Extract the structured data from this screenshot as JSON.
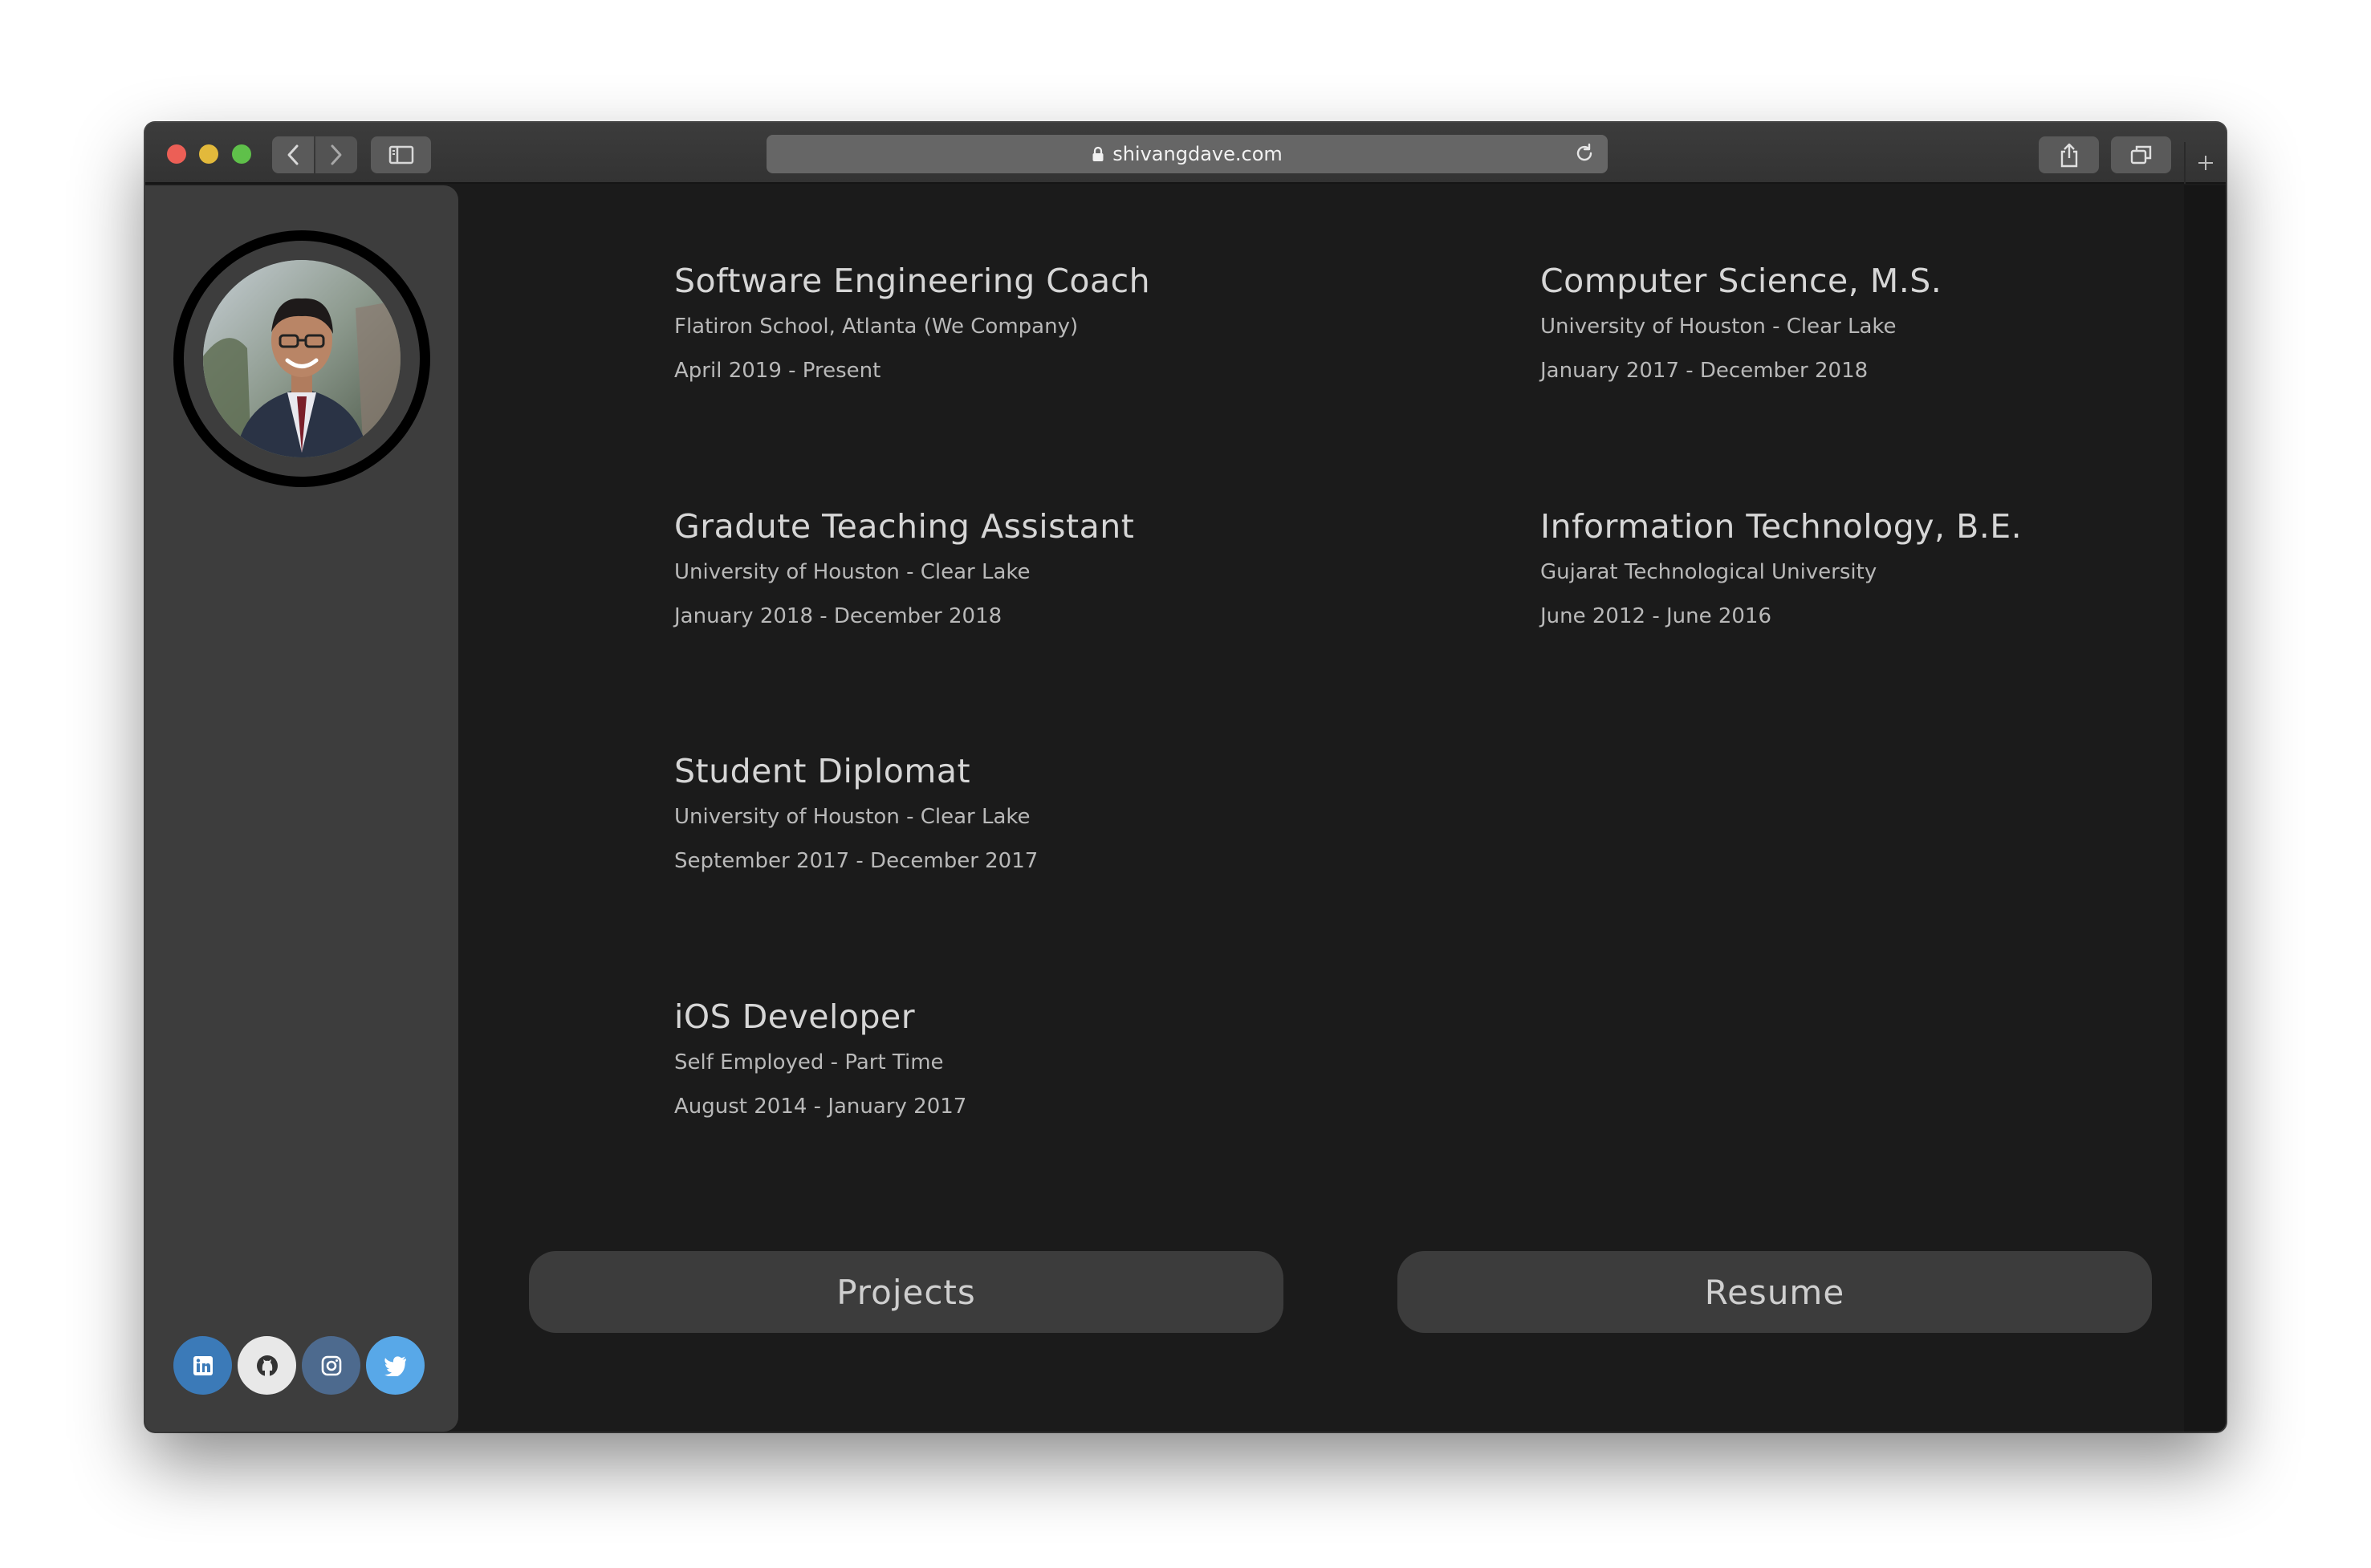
{
  "browser": {
    "url": "shivangdave.com",
    "icons": {
      "back": "chevron-left-icon",
      "forward": "chevron-right-icon",
      "sidebar": "sidebar-icon",
      "lock": "lock-icon",
      "reload": "reload-icon",
      "share": "share-icon",
      "tabs": "tabs-icon",
      "new_tab": "plus-icon"
    }
  },
  "sidebar": {
    "socials": [
      {
        "name": "linkedin",
        "icon": "linkedin-icon",
        "color": "#3b7ab8"
      },
      {
        "name": "github",
        "icon": "github-icon",
        "color": "#e8e8e8"
      },
      {
        "name": "instagram",
        "icon": "instagram-icon",
        "color": "#4d6a8e"
      },
      {
        "name": "twitter",
        "icon": "twitter-icon",
        "color": "#58a8e8"
      }
    ]
  },
  "experience": [
    {
      "title": "Software Engineering Coach",
      "org": "Flatiron School, Atlanta (We Company)",
      "dates": "April 2019 - Present"
    },
    {
      "title": "Gradute Teaching Assistant",
      "org": "University of Houston - Clear Lake",
      "dates": "January 2018 - December 2018"
    },
    {
      "title": "Student Diplomat",
      "org": "University of Houston - Clear Lake",
      "dates": "September 2017 - December 2017"
    },
    {
      "title": "iOS Developer",
      "org": "Self Employed - Part Time",
      "dates": "August 2014 - January 2017"
    }
  ],
  "education": [
    {
      "title": "Computer Science, M.S.",
      "org": "University of Houston - Clear Lake",
      "dates": "January 2017 - December 2018"
    },
    {
      "title": "Information Technology, B.E.",
      "org": "Gujarat Technological University",
      "dates": "June 2012 - June 2016"
    }
  ],
  "buttons": {
    "projects": "Projects",
    "resume": "Resume"
  },
  "colors": {
    "background": "#1b1b1b",
    "sidebar": "#3d3d3d",
    "button": "#3c3c3c",
    "text": "#d6d6d6"
  }
}
